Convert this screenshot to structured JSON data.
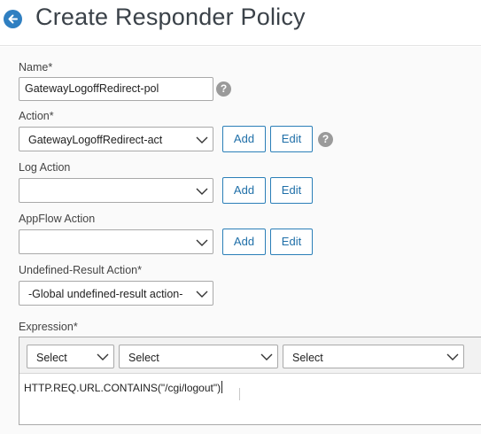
{
  "header": {
    "title": "Create Responder Policy"
  },
  "form": {
    "name": {
      "label": "Name*",
      "value": "GatewayLogoffRedirect-pol"
    },
    "action": {
      "label": "Action*",
      "selected": "GatewayLogoffRedirect-act",
      "add_label": "Add",
      "edit_label": "Edit"
    },
    "log_action": {
      "label": "Log Action",
      "selected": "",
      "add_label": "Add",
      "edit_label": "Edit"
    },
    "appflow_action": {
      "label": "AppFlow Action",
      "selected": "",
      "add_label": "Add",
      "edit_label": "Edit"
    },
    "undefined_result_action": {
      "label": "Undefined-Result Action*",
      "selected": "-Global undefined-result action-"
    },
    "expression": {
      "label": "Expression*",
      "selects": [
        "Select",
        "Select",
        "Select"
      ],
      "value": "HTTP.REQ.URL.CONTAINS(\"/cgi/logout\")"
    },
    "help_glyph": "?"
  },
  "icons": {
    "back": "back-arrow-icon",
    "help": "help-icon",
    "dropdown": "chevron-down-icon"
  },
  "colors": {
    "accent": "#2f7fc1",
    "button_border": "#2b7fb8",
    "help_bg": "#9a9a9a",
    "panel_bg": "#fafafa"
  }
}
